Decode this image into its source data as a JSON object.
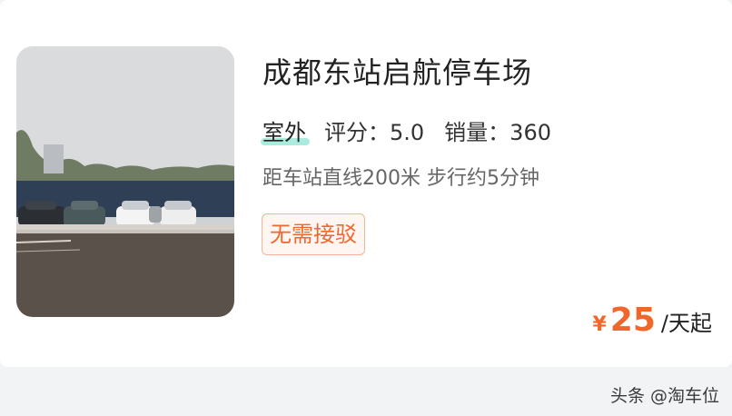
{
  "listing": {
    "title": "成都东站启航停车场",
    "type_tag": "室外",
    "rating": "评分：5.0",
    "sales": "销量：360",
    "distance": "距车站直线200米 步行约5分钟",
    "badge": "无需接驳",
    "price_currency": "¥",
    "price_value": "25",
    "price_unit": "/天起",
    "accent_color": "#f0672c"
  },
  "watermark": "头条 @淘车位"
}
